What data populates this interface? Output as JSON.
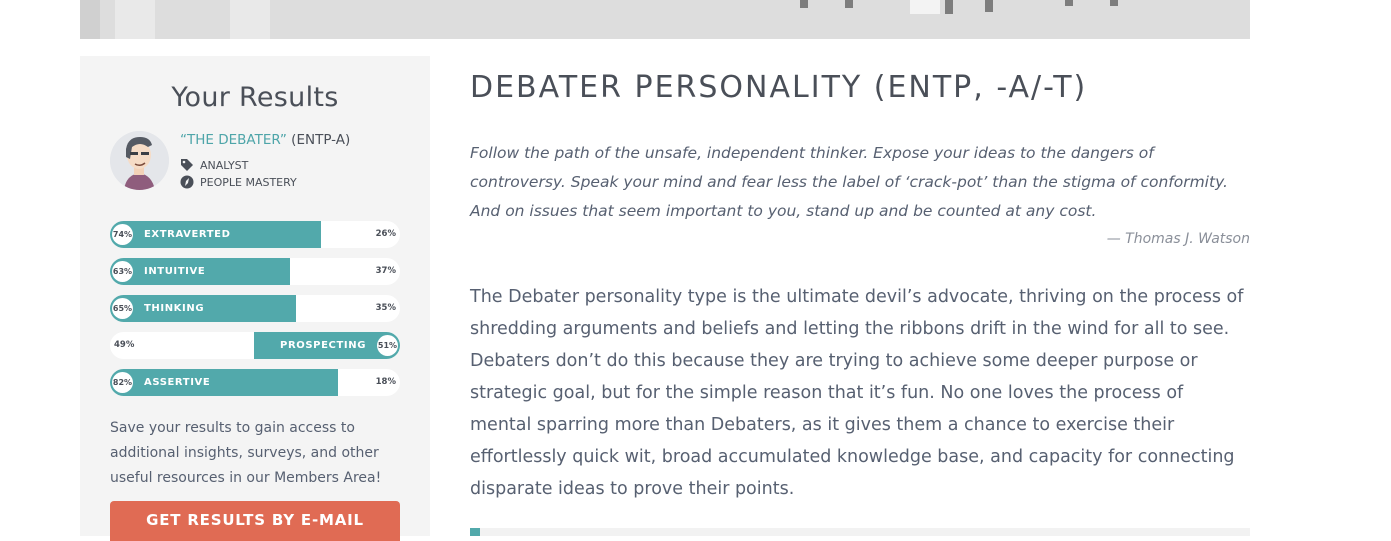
{
  "sidebar": {
    "heading": "Your Results",
    "type_name": "“THE DEBATER”",
    "type_code": "(ENTP-A)",
    "traits": [
      {
        "icon": "tag-icon",
        "label": "ANALYST"
      },
      {
        "icon": "compass-icon",
        "label": "PEOPLE MASTERY"
      }
    ],
    "bars": [
      {
        "dominant": "74%",
        "label": "EXTRAVERTED",
        "other": "26%",
        "fill_percent": 74,
        "side": "left"
      },
      {
        "dominant": "63%",
        "label": "INTUITIVE",
        "other": "37%",
        "fill_percent": 63,
        "side": "left"
      },
      {
        "dominant": "65%",
        "label": "THINKING",
        "other": "35%",
        "fill_percent": 65,
        "side": "left"
      },
      {
        "dominant": "51%",
        "label": "PROSPECTING",
        "other": "49%",
        "fill_percent": 51,
        "side": "right"
      },
      {
        "dominant": "82%",
        "label": "ASSERTIVE",
        "other": "18%",
        "fill_percent": 82,
        "side": "left"
      }
    ],
    "save_text": "Save your results to gain access to additional insights, surveys, and other useful resources in our Members Area!",
    "email_button": "GET RESULTS BY E-MAIL"
  },
  "main": {
    "title": "DEBATER PERSONALITY (ENTP, -A/-T)",
    "quote": "Follow the path of the unsafe, independent thinker. Expose your ideas to the dangers of controversy. Speak your mind and fear less the label of ‘crack-pot’ than the stigma of conformity. And on issues that seem important to you, stand up and be counted at any cost.",
    "quote_author": "— Thomas J. Watson",
    "paragraph": "The Debater personality type is the ultimate devil’s advocate, thriving on the process of shredding arguments and beliefs and letting the ribbons drift in the wind for all to see. Debaters don’t do this because they are trying to achieve some deeper purpose or strategic goal, but for the simple reason that it’s fun. No one loves the process of mental sparring more than Debaters, as it gives them a chance to exercise their effortlessly quick wit, broad accumulated knowledge base, and capacity for connecting disparate ideas to prove their points."
  },
  "colors": {
    "accent": "#52a9ab",
    "button": "#e06b54",
    "sidebar_bg": "#f4f4f4"
  }
}
